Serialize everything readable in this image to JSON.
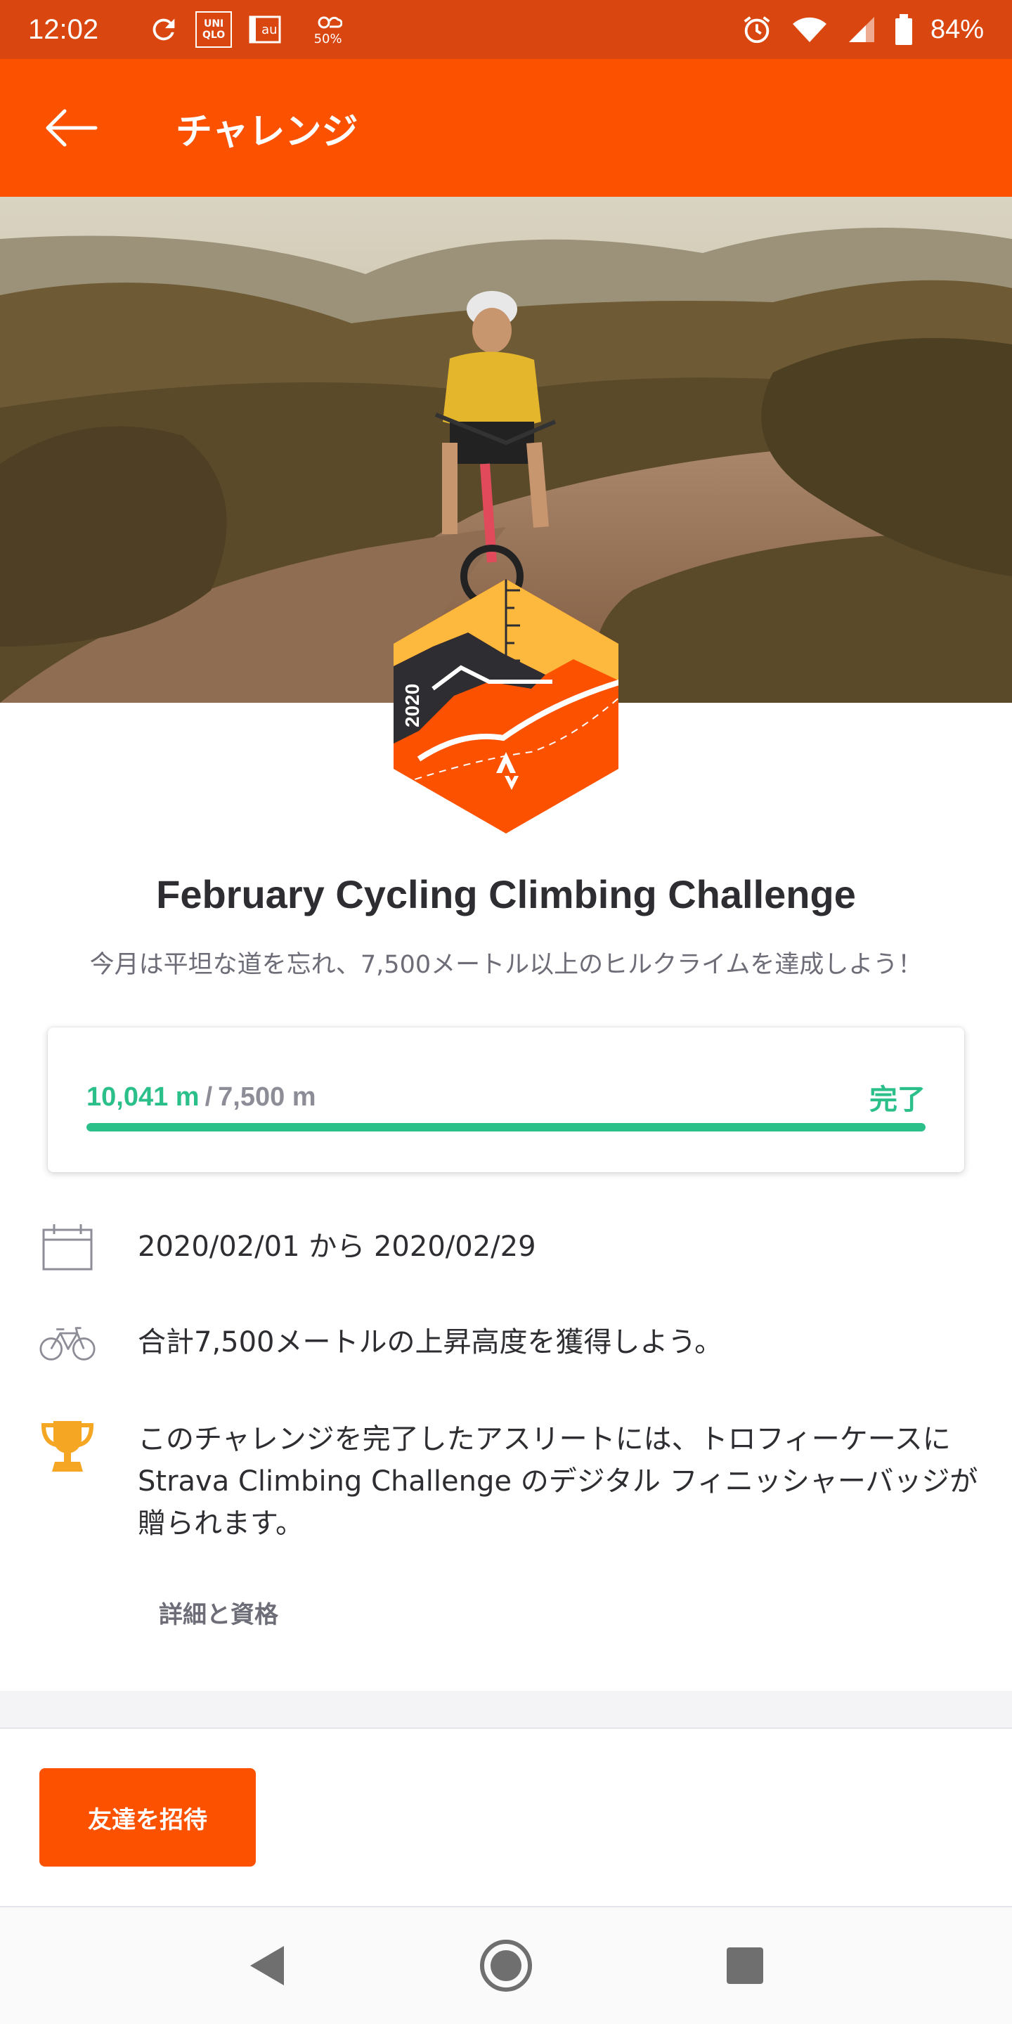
{
  "status_bar": {
    "time": "12:02",
    "notification_icons": [
      "sync-icon",
      "uniqlo-app-icon",
      "au-app-icon",
      "weather-icon"
    ],
    "uniqlo_text": "UNI QLO",
    "au_text": "au",
    "weather_percent": "50%",
    "battery_percent": "84%"
  },
  "app_bar": {
    "title": "チャレンジ",
    "back_icon": "arrow-left-icon"
  },
  "badge": {
    "year": "2020"
  },
  "challenge": {
    "title": "February Cycling Climbing Challenge",
    "subtitle": "今月は平坦な道を忘れ、7,500メートル以上のヒルクライムを達成しよう！"
  },
  "progress": {
    "current": "10,041 m",
    "separator": "/",
    "goal": "7,500 m",
    "status": "完了",
    "fraction": 1.0,
    "color": "#2bbf8a"
  },
  "info": {
    "dates": "2020/02/01 から 2020/02/29",
    "goal_text": "合計7,500メートルの上昇高度を獲得しよう。",
    "reward_text": "このチャレンジを完了したアスリートには、トロフィーケースに Strava Climbing Challenge のデジタル フィニッシャーバッジが贈られます。",
    "details_link": "詳細と資格"
  },
  "actions": {
    "invite_label": "友達を招待"
  },
  "colors": {
    "brand": "#fc5200",
    "status_bar": "#d9460f",
    "success": "#2bbf8a",
    "trophy": "#f5a623"
  }
}
